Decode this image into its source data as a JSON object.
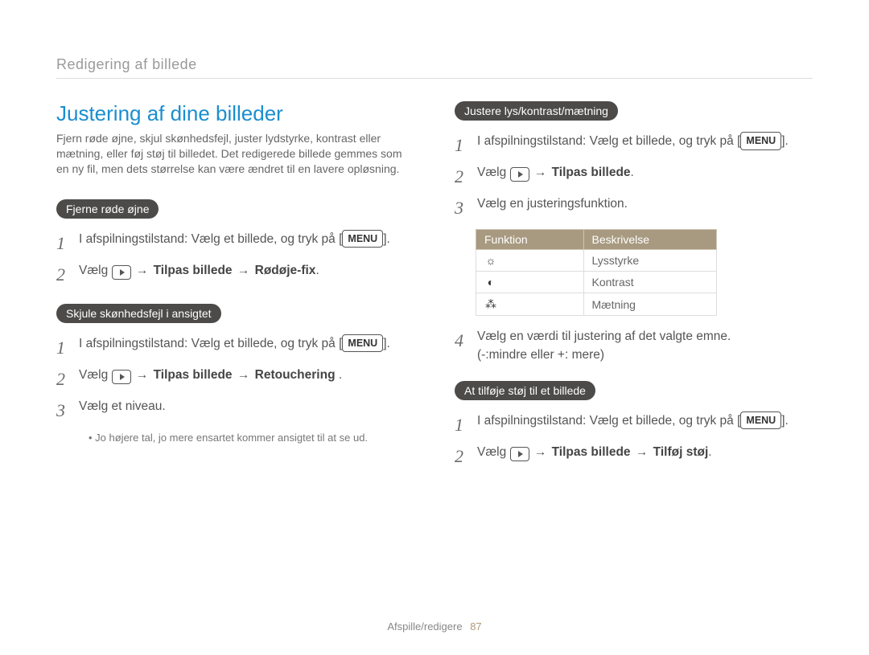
{
  "breadcrumb": "Redigering af billede",
  "title": "Justering af dine billeder",
  "intro": "Fjern røde øjne, skjul skønhedsfejl, juster lydstyrke, kontrast eller mætning, eller føj støj til billedet. Det redigerede billede gemmes som en ny fil, men dets størrelse kan være ændret til en lavere opløsning.",
  "menu_label": "MENU",
  "arrow": "→",
  "sections": {
    "redEye": {
      "pill": "Fjerne røde øjne",
      "step1_a": "I afspilningstilstand: Vælg et billede, og tryk på [",
      "step1_b": "].",
      "step2_a": "Vælg ",
      "step2_b": " Tilpas billede ",
      "step2_c": " Rødøje-fix",
      "step2_end": "."
    },
    "retouch": {
      "pill": "Skjule skønhedsfejl i ansigtet",
      "step1_a": "I afspilningstilstand: Vælg et billede, og tryk på [",
      "step1_b": "].",
      "step2_a": "Vælg ",
      "step2_b": " Tilpas billede ",
      "step2_c": " Retouchering ",
      "step2_end": ".",
      "step3": "Vælg et niveau.",
      "note": "Jo højere tal, jo mere ensartet kommer ansigtet til at se ud."
    },
    "adjust": {
      "pill": "Justere lys/kontrast/mætning",
      "step1_a": "I afspilningstilstand: Vælg et billede, og tryk på [",
      "step1_b": "].",
      "step2_a": "Vælg ",
      "step2_b": " Tilpas billede",
      "step2_end": ".",
      "step3": "Vælg en justeringsfunktion.",
      "table": {
        "headers": {
          "func": "Funktion",
          "desc": "Beskrivelse"
        },
        "rows": [
          {
            "icon": "☼",
            "label": "Lysstyrke"
          },
          {
            "icon": "◐",
            "label": "Kontrast"
          },
          {
            "icon": "⁂",
            "label": "Mætning"
          }
        ]
      },
      "step4_a": "Vælg en værdi til justering af det valgte emne.",
      "step4_b": "(-:mindre eller +: mere)"
    },
    "noise": {
      "pill": "At tilføje støj til et billede",
      "step1_a": "I afspilningstilstand: Vælg et billede, og tryk på [",
      "step1_b": "].",
      "step2_a": "Vælg ",
      "step2_b": " Tilpas billede ",
      "step2_c": " Tilføj støj",
      "step2_end": "."
    }
  },
  "footer": {
    "section": "Afspille/redigere",
    "page": "87"
  }
}
